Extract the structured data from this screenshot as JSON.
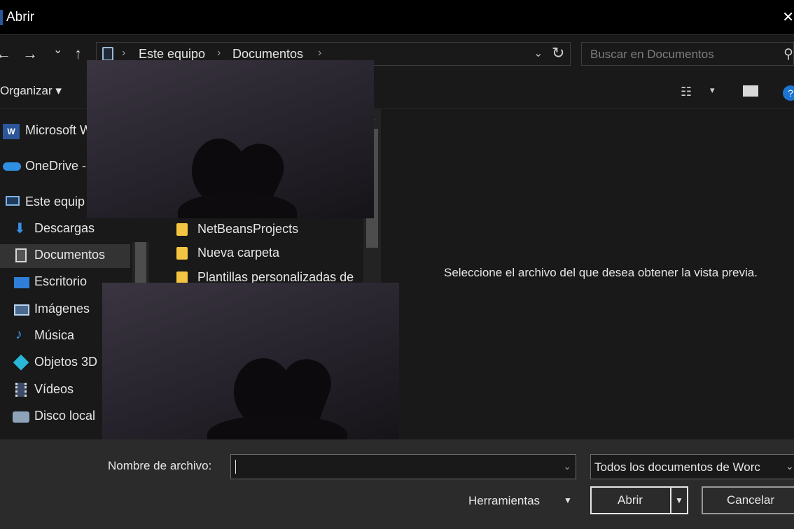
{
  "window": {
    "title": "Abrir"
  },
  "nav": {
    "back": "←",
    "forward": "→",
    "recent": "⌄",
    "up": "↑"
  },
  "address": {
    "crumbs": [
      "Este equipo",
      "Documentos"
    ],
    "separator": "›",
    "dropdown": "⌄",
    "refresh": "↻"
  },
  "search": {
    "placeholder": "Buscar en Documentos"
  },
  "toolbar": {
    "organize": "Organizar ▾",
    "view_dropdown": "▾",
    "help": "?"
  },
  "sidebar": {
    "items": [
      {
        "label": "Microsoft W",
        "icon": "word-icon"
      },
      {
        "label": "OneDrive -",
        "icon": "onedrive-icon"
      },
      {
        "label": "Este equip",
        "icon": "computer-icon"
      },
      {
        "label": "Descargas",
        "icon": "download-icon"
      },
      {
        "label": "Documentos",
        "icon": "documents-icon"
      },
      {
        "label": "Escritorio",
        "icon": "desktop-icon"
      },
      {
        "label": "Imágenes",
        "icon": "pictures-icon"
      },
      {
        "label": "Música",
        "icon": "music-icon"
      },
      {
        "label": "Objetos 3D",
        "icon": "objects3d-icon"
      },
      {
        "label": "Vídeos",
        "icon": "videos-icon"
      },
      {
        "label": "Disco local",
        "icon": "local-disk-icon"
      }
    ]
  },
  "files": {
    "items": [
      {
        "label": "NetBeansProjects"
      },
      {
        "label": "Nueva carpeta"
      },
      {
        "label": "Plantillas personalizadas de"
      }
    ]
  },
  "preview": {
    "message": "Seleccione el archivo del que desea obtener la vista previa."
  },
  "footer": {
    "filename_label": "Nombre de archivo:",
    "filename_value": "",
    "filter_label": "Todos los documentos de Worc",
    "tools_label": "Herramientas",
    "open_label": "Abrir",
    "cancel_label": "Cancelar"
  },
  "colors": {
    "accent": "#1b75d0",
    "folder": "#f4c542",
    "background": "#191919"
  }
}
